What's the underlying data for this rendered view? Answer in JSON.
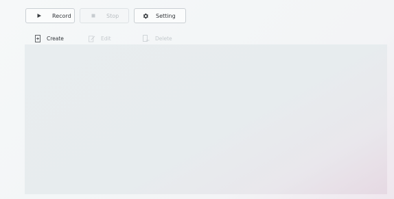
{
  "toolbar": {
    "record_label": "Record",
    "stop_label": "Stop",
    "setting_label": "Setting",
    "record_icon": "play-icon",
    "stop_icon": "stop-icon",
    "setting_icon": "gear-icon"
  },
  "actions": {
    "create_label": "Create",
    "edit_label": "Edit",
    "delete_label": "Delete",
    "create_icon": "create-icon",
    "edit_icon": "edit-icon",
    "delete_icon": "delete-icon"
  },
  "colors": {
    "text": "#2f3337",
    "disabled_text": "#b8bdc1",
    "panel": "#e8edef"
  }
}
